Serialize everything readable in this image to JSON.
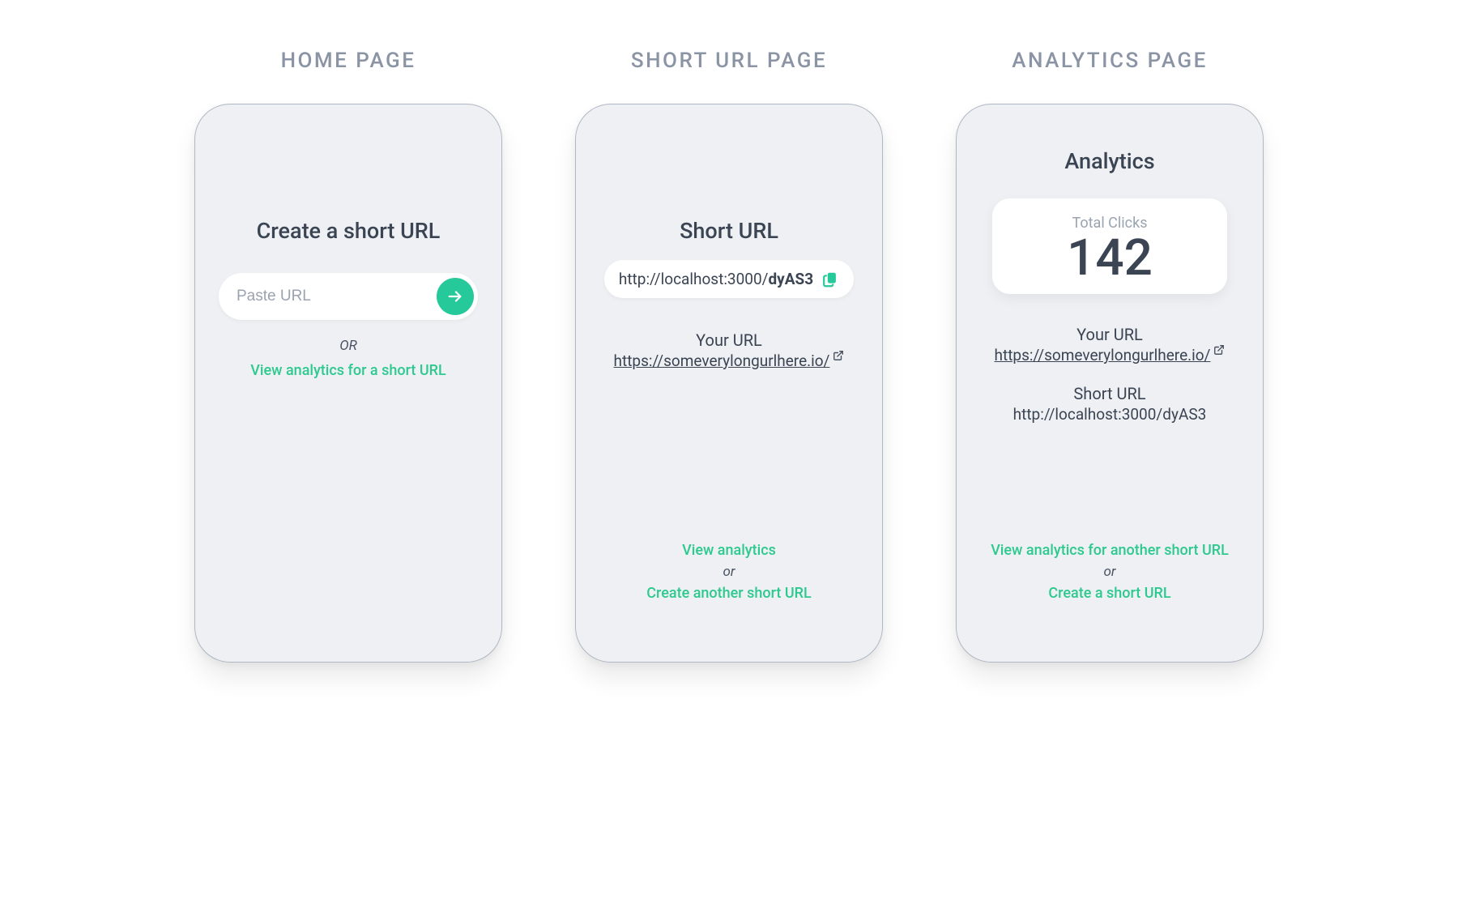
{
  "home": {
    "page_title": "HOME PAGE",
    "heading": "Create a short URL",
    "input_placeholder": "Paste URL",
    "or_label": "OR",
    "analytics_link": "View analytics for a short URL"
  },
  "short": {
    "page_title": "SHORT URL PAGE",
    "heading": "Short URL",
    "short_url_prefix": "http://localhost:3000/",
    "short_url_code": "dyAS3",
    "your_url_label": "Your URL",
    "your_url_value": "https://someverylongurlhere.io/",
    "view_analytics_label": "View analytics",
    "or_label": "or",
    "create_another_label": "Create another short URL"
  },
  "analytics": {
    "page_title": "ANALYTICS PAGE",
    "heading": "Analytics",
    "metric_label": "Total Clicks",
    "metric_value": "142",
    "your_url_label": "Your URL",
    "your_url_value": "https://someverylongurlhere.io/",
    "short_url_label": "Short URL",
    "short_url_value": "http://localhost:3000/dyAS3",
    "view_another_label": "View analytics for another short URL",
    "or_label": "or",
    "create_label": "Create a short URL"
  },
  "colors": {
    "accent": "#26c99a"
  }
}
